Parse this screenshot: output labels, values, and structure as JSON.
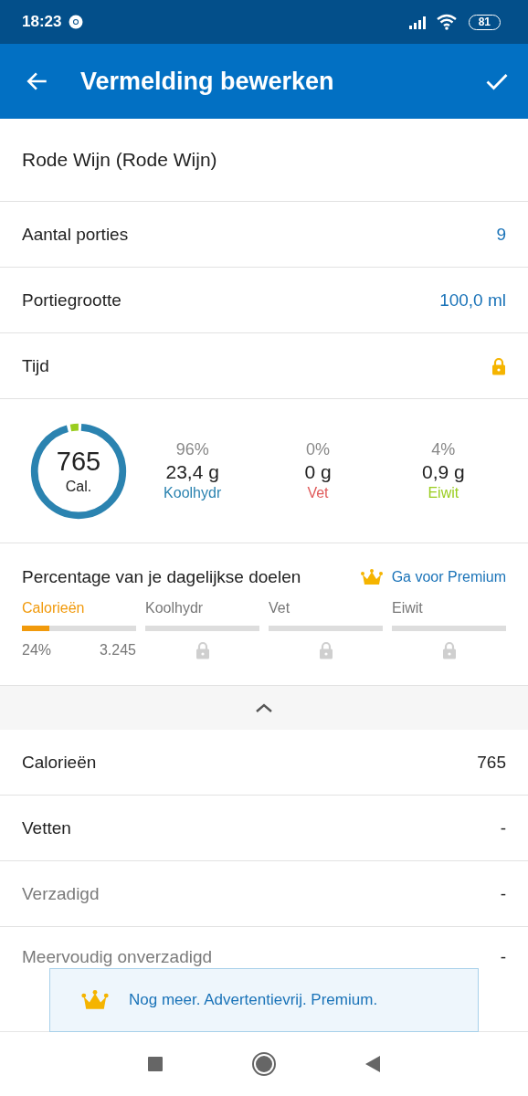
{
  "status_bar": {
    "time": "18:23",
    "battery": "81"
  },
  "app_bar": {
    "title": "Vermelding bewerken"
  },
  "food_name": "Rode Wijn (Rode Wijn)",
  "fields": [
    {
      "label": "Aantal porties",
      "kind": "value",
      "value": "9"
    },
    {
      "label": "Portiegrootte",
      "kind": "value",
      "value": "100,0 ml"
    },
    {
      "label": "Tijd",
      "kind": "locked"
    }
  ],
  "summary": {
    "calories": "765",
    "unit": "Cal.",
    "macros": [
      {
        "pct": "96%",
        "amount": "23,4 g",
        "name": "Koolhydr",
        "color": "#2b83b0"
      },
      {
        "pct": "0%",
        "amount": "0 g",
        "name": "Vet",
        "color": "#e05a5a"
      },
      {
        "pct": "4%",
        "amount": "0,9 g",
        "name": "Eiwit",
        "color": "#9acd1f"
      }
    ]
  },
  "goals": {
    "title": "Percentage van je dagelijkse doelen",
    "premium_link": "Ga voor Premium",
    "items": [
      {
        "name": "Calorieën",
        "kind": "progress",
        "level": 0.24,
        "percent": "24%",
        "goal": "3.245"
      },
      {
        "name": "Koolhydr",
        "kind": "locked"
      },
      {
        "name": "Vet",
        "kind": "locked"
      },
      {
        "name": "Eiwit",
        "kind": "locked"
      }
    ]
  },
  "nutrients": [
    {
      "label": "Calorieën",
      "value": "765",
      "sub": false
    },
    {
      "label": "Vetten",
      "value": "-",
      "sub": false
    },
    {
      "label": "Verzadigd",
      "value": "-",
      "sub": true
    },
    {
      "label": "Meervoudig onverzadigd",
      "value": "-",
      "sub": true
    }
  ],
  "banner": {
    "text": "Nog meer. Advertentievrij. Premium."
  }
}
